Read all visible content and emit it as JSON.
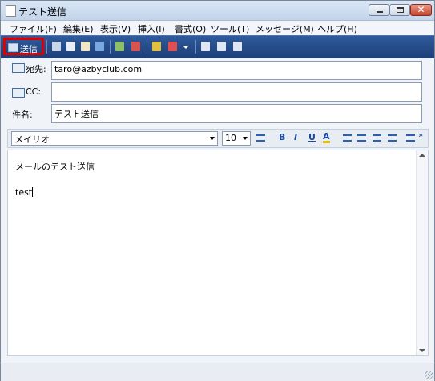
{
  "window": {
    "title": "テスト送信"
  },
  "menu": [
    "ファイル(F)",
    "編集(E)",
    "表示(V)",
    "挿入(I)",
    "書式(O)",
    "ツール(T)",
    "メッセージ(M)",
    "ヘルプ(H)"
  ],
  "toolbar": {
    "send_label": "送信"
  },
  "header": {
    "to_label": "宛先:",
    "to_value": "taro@azbyclub.com",
    "cc_label": "CC:",
    "cc_value": "",
    "subject_label": "件名:",
    "subject_value": "テスト送信"
  },
  "format": {
    "font": "メイリオ",
    "size": "10",
    "bold": "B",
    "italic": "I",
    "underline": "U",
    "font_color": "A"
  },
  "body": {
    "line1": "メールのテスト送信",
    "line2": "test"
  },
  "colors": {
    "toolbar": "#1f4580",
    "send_highlight": "#e00000"
  }
}
